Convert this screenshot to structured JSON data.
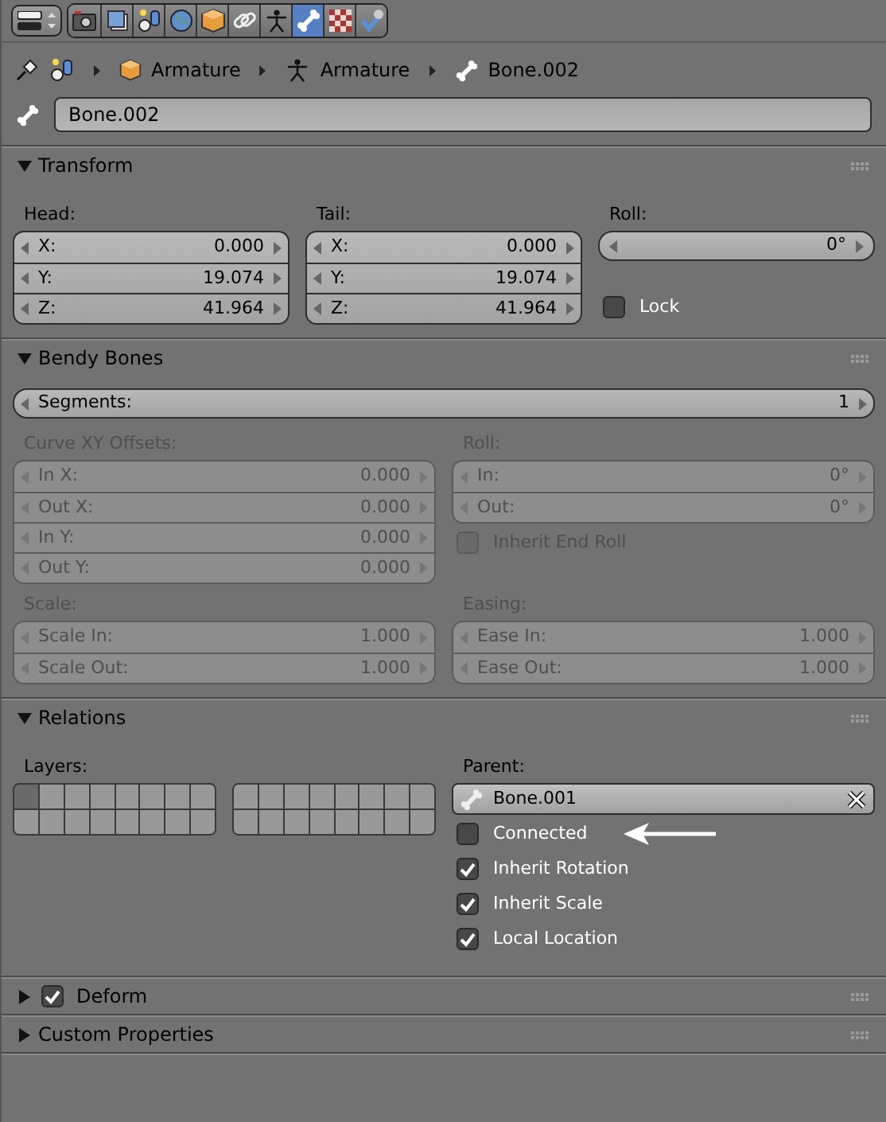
{
  "toolbar": {
    "tabs": [
      {
        "selected": false
      },
      {
        "selected": false
      },
      {
        "selected": false
      },
      {
        "selected": false
      },
      {
        "selected": false
      },
      {
        "selected": false
      },
      {
        "selected": false
      },
      {
        "selected": true
      },
      {
        "selected": false
      },
      {
        "selected": false
      }
    ]
  },
  "breadcrumb": [
    "Armature",
    "Armature",
    "Bone.002"
  ],
  "bone_name": {
    "value": "Bone.002"
  },
  "transform": {
    "title": "Transform",
    "expanded": true,
    "head": {
      "label": "Head:",
      "disabled": false,
      "fields": [
        {
          "label": "X:",
          "value": "0.000"
        },
        {
          "label": "Y:",
          "value": "19.074"
        },
        {
          "label": "Z:",
          "value": "41.964"
        }
      ]
    },
    "tail": {
      "label": "Tail:",
      "disabled": false,
      "fields": [
        {
          "label": "X:",
          "value": "0.000"
        },
        {
          "label": "Y:",
          "value": "19.074"
        },
        {
          "label": "Z:",
          "value": "41.964"
        }
      ]
    },
    "roll": {
      "label": "Roll:",
      "value": "0°"
    },
    "lock": {
      "label": "Lock",
      "checked": false,
      "disabled": false
    }
  },
  "bendy_bones": {
    "title": "Bendy Bones",
    "expanded": true,
    "segments": {
      "label": "Segments:",
      "value": "1"
    },
    "curve_offsets": {
      "label": "Curve XY Offsets:",
      "disabled": true,
      "fields": [
        {
          "label": "In X:",
          "value": "0.000"
        },
        {
          "label": "Out X:",
          "value": "0.000"
        },
        {
          "label": "In Y:",
          "value": "0.000"
        },
        {
          "label": "Out Y:",
          "value": "0.000"
        }
      ]
    },
    "roll": {
      "label": "Roll:",
      "disabled": true,
      "fields": [
        {
          "label": "In:",
          "value": "0°"
        },
        {
          "label": "Out:",
          "value": "0°"
        }
      ]
    },
    "inherit_end_roll": {
      "label": "Inherit End Roll",
      "checked": false,
      "disabled": true
    },
    "scale": {
      "label": "Scale:",
      "disabled": true,
      "fields": [
        {
          "label": "Scale In:",
          "value": "1.000"
        },
        {
          "label": "Scale Out:",
          "value": "1.000"
        }
      ]
    },
    "easing": {
      "label": "Easing:",
      "disabled": true,
      "fields": [
        {
          "label": "Ease In:",
          "value": "1.000"
        },
        {
          "label": "Ease Out:",
          "value": "1.000"
        }
      ]
    }
  },
  "relations": {
    "title": "Relations",
    "expanded": true,
    "layers": {
      "label": "Layers:",
      "cells": [
        {
          "on": true
        },
        {
          "on": false
        },
        {
          "on": false
        },
        {
          "on": false
        },
        {
          "on": false
        },
        {
          "on": false
        },
        {
          "on": false
        },
        {
          "on": false
        },
        {
          "on": false
        },
        {
          "on": false
        },
        {
          "on": false
        },
        {
          "on": false
        },
        {
          "on": false
        },
        {
          "on": false
        },
        {
          "on": false
        },
        {
          "on": false
        },
        {
          "on": false
        },
        {
          "on": false
        },
        {
          "on": false
        },
        {
          "on": false
        },
        {
          "on": false
        },
        {
          "on": false
        },
        {
          "on": false
        },
        {
          "on": false
        },
        {
          "on": false
        },
        {
          "on": false
        },
        {
          "on": false
        },
        {
          "on": false
        },
        {
          "on": false
        },
        {
          "on": false
        },
        {
          "on": false
        },
        {
          "on": false
        }
      ]
    },
    "parent": {
      "label": "Parent:",
      "value": "Bone.001"
    },
    "options": [
      {
        "label": "Connected",
        "checked": false,
        "pointed_at": true
      },
      {
        "label": "Inherit Rotation",
        "checked": true,
        "pointed_at": false
      },
      {
        "label": "Inherit Scale",
        "checked": true,
        "pointed_at": false
      },
      {
        "label": "Local Location",
        "checked": true,
        "pointed_at": false
      }
    ]
  },
  "deform": {
    "title": "Deform",
    "expanded": false,
    "enabled": true
  },
  "custom_properties": {
    "title": "Custom Properties",
    "expanded": false
  }
}
